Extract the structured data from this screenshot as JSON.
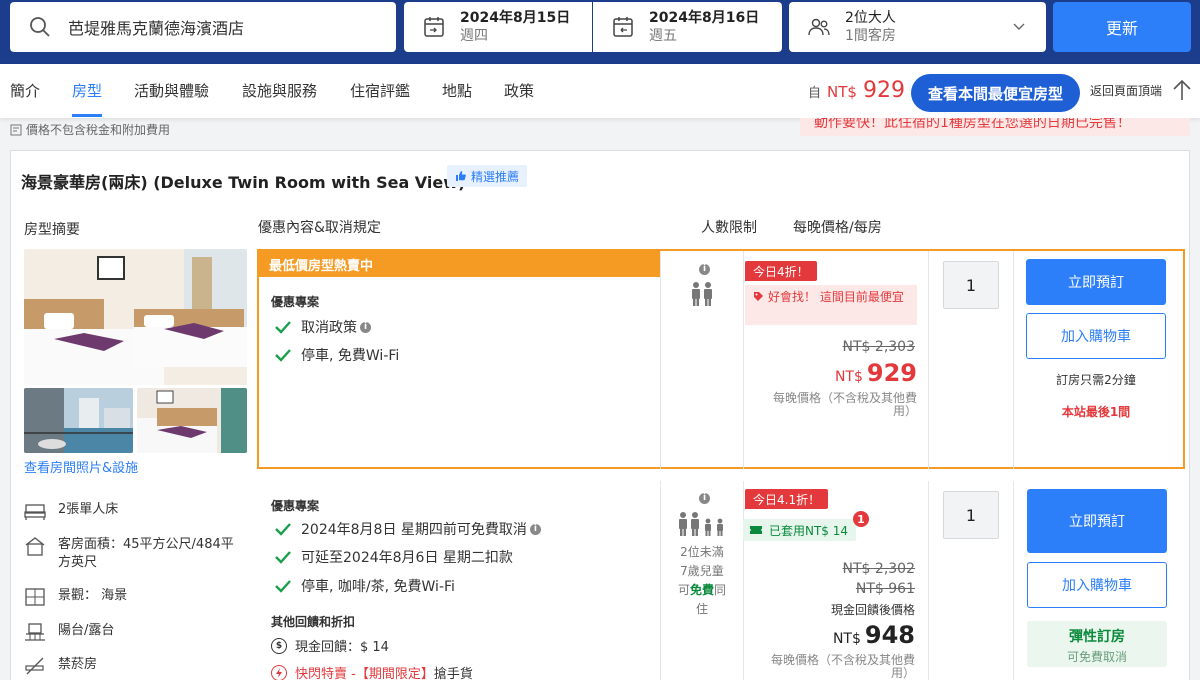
{
  "search": {
    "hotel": "芭堤雅馬克蘭德海濱酒店"
  },
  "checkin": {
    "date": "2024年8月15日",
    "weekday": "週四"
  },
  "checkout": {
    "date": "2024年8月16日",
    "weekday": "週五"
  },
  "guests": {
    "adults": "2位大人",
    "rooms": "1間客房"
  },
  "update_label": "更新",
  "tabs": [
    "簡介",
    "房型",
    "活動與體驗",
    "設施與服務",
    "住宿評鑑",
    "地點",
    "政策"
  ],
  "active_tab": "房型",
  "header_price": {
    "prefix": "自",
    "currency": "NT$",
    "amount": "929"
  },
  "cheapest_button": "查看本間最便宜房型",
  "back_to_top": "返回頁面頂端",
  "tax_note": "價格不包含稅金和附加費用",
  "alert_text": "動作要快！此住宿的1種房型在您選的日期已完售！",
  "room": {
    "title": "海景豪華房(兩床) (Deluxe Twin Room with Sea View)",
    "badge": "精選推薦",
    "col_summary": "房型摘要",
    "col_offer": "優惠內容&取消規定",
    "col_people": "人數限制",
    "col_price": "每晚價格/每房",
    "see_photos": "查看房間照片&設施",
    "amenities": {
      "bed": "2張單人床",
      "area": "客房面積：45平方公尺/484平方英尺",
      "view": "景觀： 海景",
      "balcony": "陽台/露台",
      "nosmoke": "禁菸房"
    }
  },
  "offer1": {
    "hot_label": "最低價房型熱賣中",
    "section": "優惠專案",
    "items": [
      "取消政策",
      "停車, 免費Wi-Fi"
    ],
    "discount": "今日4折！",
    "deal": "好會找！ 這間目前最便宜",
    "old_price": "NT$ 2,303",
    "currency": "NT$",
    "price": "929",
    "price_note": "每晚價格（不含稅及其他費用）",
    "qty": "1",
    "book": "立即預訂",
    "cart": "加入購物車",
    "quick_note": "訂房只需2分鐘",
    "last_room": "本站最後1間"
  },
  "offer2": {
    "section": "優惠專案",
    "items": [
      "2024年8月8日 星期四前可免費取消",
      "可延至2024年8月6日 星期二扣款",
      "停車, 咖啡/茶, 免費Wi-Fi"
    ],
    "other_section": "其他回饋和折扣",
    "cashback": "現金回饋：$ 14",
    "flash_prefix": "快閃特賣 - ",
    "flash_highlight": "【期間限定】",
    "flash_suffix": " 搶手貨",
    "people_note_1": "2位未滿",
    "people_note_2": "7歲兒童",
    "people_note_3a": "可",
    "people_note_3b": "免費",
    "people_note_3c": "同",
    "people_note_4": "住",
    "discount": "今日4.1折！",
    "cashback_tag": "已套用NT$ 14",
    "badge_count": "1",
    "old_price_1": "NT$ 2,302",
    "old_price_2": "NT$ 961",
    "after_cashback": "現金回饋後價格",
    "currency": "NT$",
    "price": "948",
    "price_note": "每晚價格（不含稅及其他費用）",
    "qty": "1",
    "book": "立即預訂",
    "cart": "加入購物車",
    "flex_title": "彈性訂房",
    "flex_sub": "可免費取消"
  },
  "colors": {
    "accent": "#2d7ff9",
    "price_red": "#e4393c",
    "hot_orange": "#f59a23",
    "green": "#0a8a3c",
    "topbar": "#1c3c8c"
  }
}
